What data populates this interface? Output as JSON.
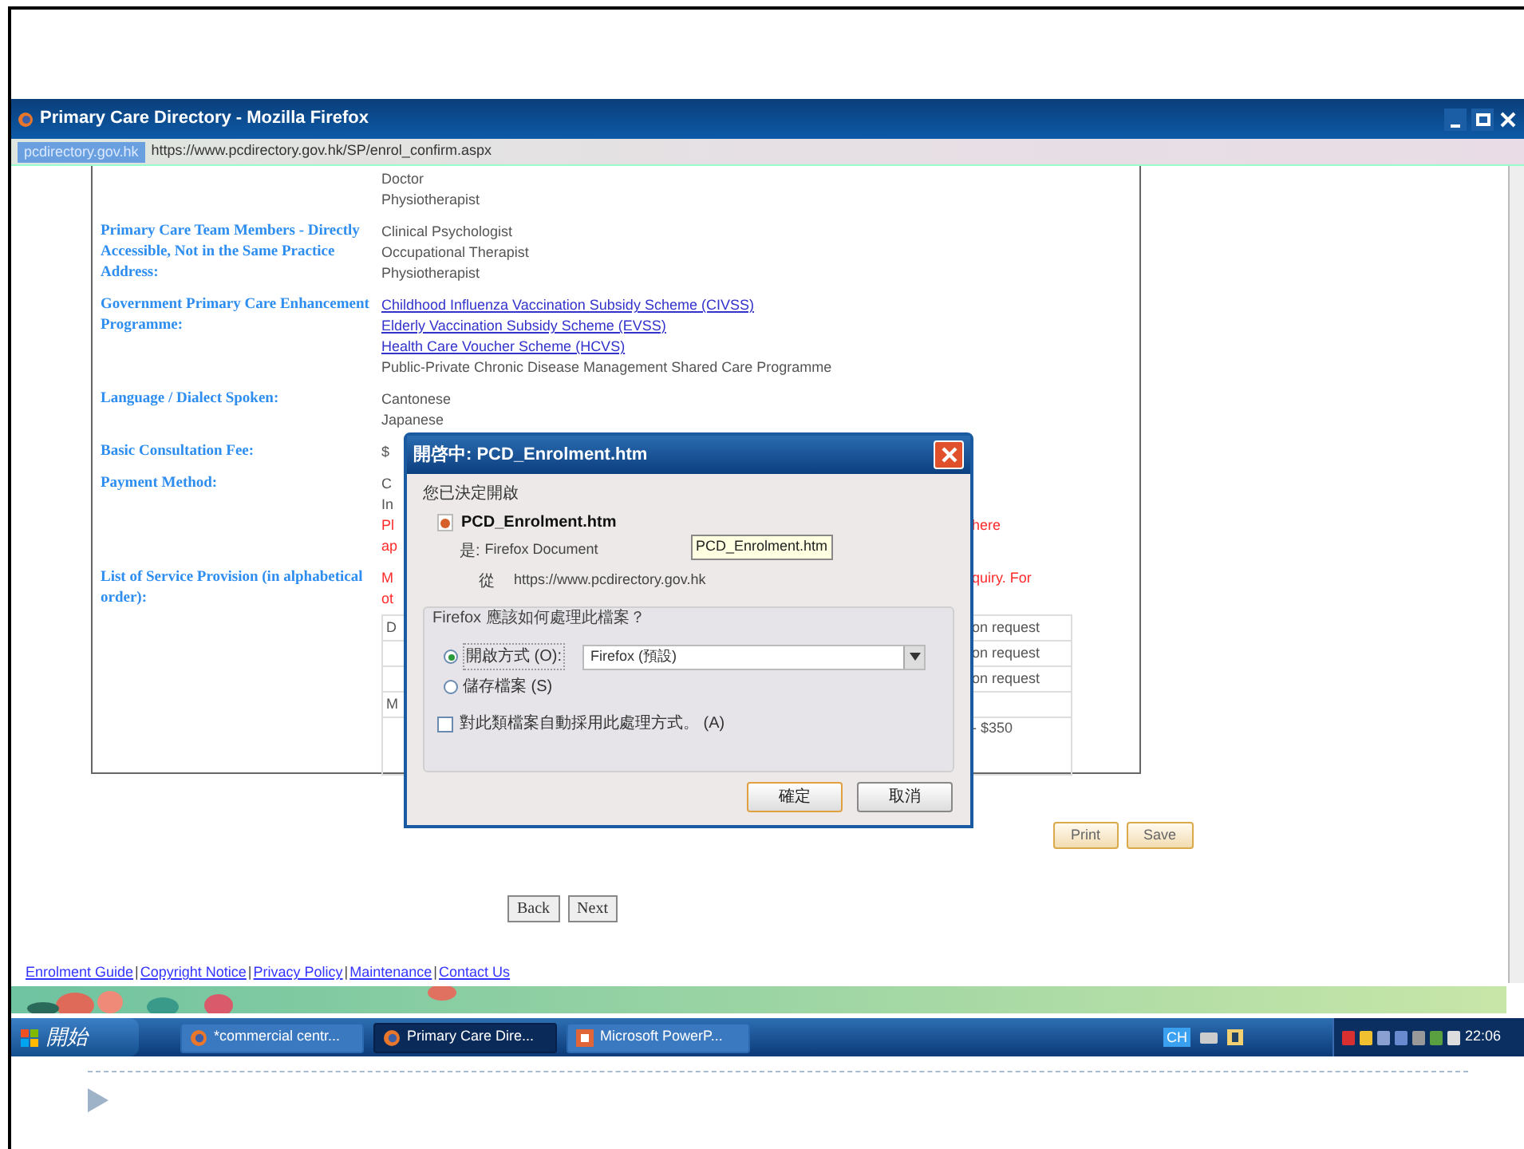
{
  "browser": {
    "title": "Primary Care Directory - Mozilla Firefox",
    "site_badge": "pcdirectory.gov.hk",
    "url": "https://www.pcdirectory.gov.hk/SP/enrol_confirm.aspx"
  },
  "details": [
    {
      "values": [
        {
          "text": "Doctor",
          "kind": "plain"
        },
        {
          "text": "Physiotherapist",
          "kind": "plain"
        }
      ]
    },
    {
      "label": "Primary Care Team Members - Directly Accessible, Not in the Same Practice Address:",
      "values": [
        {
          "text": "Clinical Psychologist",
          "kind": "plain"
        },
        {
          "text": "Occupational Therapist",
          "kind": "plain"
        },
        {
          "text": "Physiotherapist",
          "kind": "plain"
        }
      ]
    },
    {
      "label": "Government Primary Care Enhancement Programme:",
      "values": [
        {
          "text": "Childhood Influenza Vaccination Subsidy Scheme (CIVSS)",
          "kind": "link"
        },
        {
          "text": "Elderly Vaccination Subsidy Scheme (EVSS)",
          "kind": "link"
        },
        {
          "text": "Health Care Voucher Scheme (HCVS)",
          "kind": "link"
        },
        {
          "text": "Public-Private Chronic Disease Management Shared Care Programme",
          "kind": "plain"
        }
      ]
    },
    {
      "label": "Language / Dialect Spoken:",
      "values": [
        {
          "text": "Cantonese",
          "kind": "plain"
        },
        {
          "text": "Japanese",
          "kind": "plain"
        }
      ]
    },
    {
      "label": "Basic Consultation Fee:",
      "values": [
        {
          "text": "$",
          "kind": "plain"
        }
      ]
    },
    {
      "label": "Payment Method:",
      "values": [
        {
          "text": "C",
          "kind": "plain"
        },
        {
          "text": "In",
          "kind": "plain"
        },
        {
          "text": "Pl",
          "kind": "alert",
          "right": "here"
        },
        {
          "text": "ap",
          "kind": "alert"
        }
      ]
    },
    {
      "label": "List of Service Provision (in alphabetical order):",
      "values": [
        {
          "text": "M",
          "kind": "alert",
          "right": "quiry. For"
        },
        {
          "text": "ot",
          "kind": "alert"
        }
      ]
    }
  ],
  "service_table": [
    {
      "left": "D",
      "right": "on request"
    },
    {
      "right": "on request"
    },
    {
      "right": "on request"
    },
    {
      "left": "M"
    },
    {
      "right": "- $350"
    }
  ],
  "page_buttons": [
    "Print",
    "Save"
  ],
  "nav_buttons": [
    "Back",
    "Next"
  ],
  "footer_links": [
    {
      "kind": "link",
      "text": "Enrolment Guide"
    },
    {
      "kind": "separator",
      "text": "|"
    },
    {
      "kind": "link",
      "text": "Copyright Notice"
    },
    {
      "kind": "separator",
      "text": "|"
    },
    {
      "kind": "link",
      "text": "Privacy Policy"
    },
    {
      "kind": "separator",
      "text": "|"
    },
    {
      "kind": "link",
      "text": "Maintenance"
    },
    {
      "kind": "separator",
      "text": "|"
    },
    {
      "kind": "link",
      "text": "Contact Us"
    }
  ],
  "dialog": {
    "title": "開啓中: PCD_Enrolment.htm",
    "intro": "您已決定開啟",
    "file_name": "PCD_Enrolment.htm",
    "type_label": "是:",
    "type_value": "Firefox Document",
    "from_label": "從",
    "from_value": "https://www.pcdirectory.gov.hk",
    "tooltip": "PCD_Enrolment.htm",
    "group_title": "Firefox 應該如何處理此檔案？",
    "options": [
      {
        "label": "開啟方式 (O):",
        "selected": true
      },
      {
        "label": "儲存檔案 (S)",
        "selected": false
      }
    ],
    "open_with": "Firefox (預設)",
    "remember": {
      "label": "對此類檔案自動採用此處理方式。 (A)",
      "checked": false
    },
    "buttons": [
      "確定",
      "取消"
    ]
  },
  "taskbar": {
    "start": "開始",
    "tasks": [
      {
        "label": "*commercial centr...",
        "kind": "firefox",
        "selected": false
      },
      {
        "label": "Primary Care Dire...",
        "kind": "firefox",
        "selected": true
      },
      {
        "label": "Microsoft PowerP...",
        "kind": "powerpoint",
        "selected": false
      }
    ],
    "language": "CH",
    "clock": "22:06"
  }
}
